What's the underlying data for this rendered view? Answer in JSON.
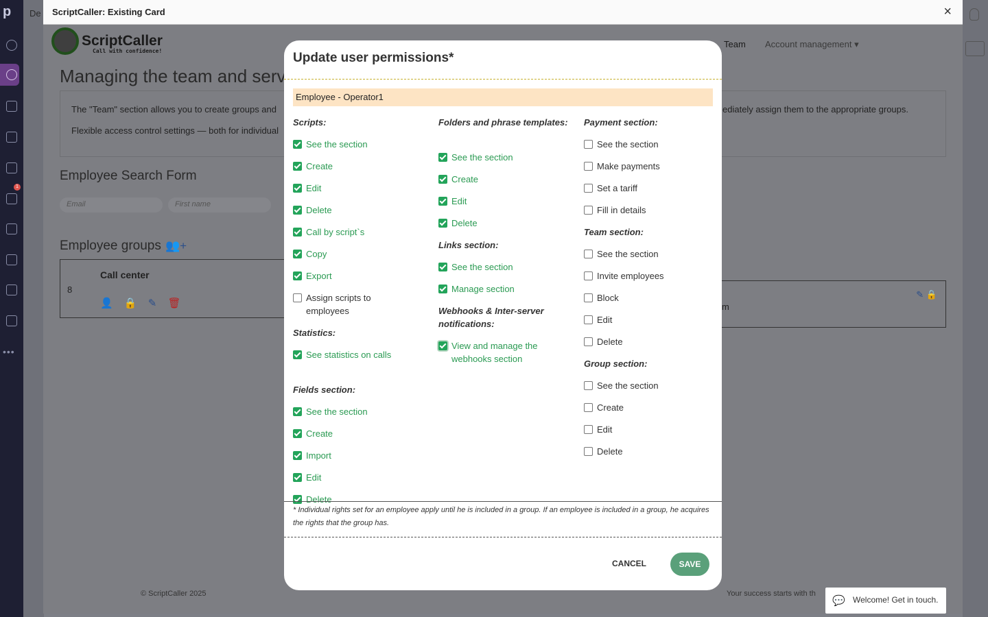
{
  "window": {
    "title": "ScriptCaller: Existing Card",
    "close_glyph": "×"
  },
  "background": {
    "strip_text": "De",
    "brand": {
      "name": "ScriptCaller",
      "tagline": "Call with confidence!"
    },
    "nav": {
      "team": "Team",
      "account": "Account management ▾"
    },
    "heading": "Managing the team and serv",
    "info_line1": "The \"Team\" section allows you to create groups and",
    "info_line1_end": "ediately assign them to the appropriate groups.",
    "info_line2": "Flexible access control settings — both for individual",
    "search_heading": "Employee Search Form",
    "search_email": "Email",
    "search_first": "First name",
    "groups_heading": "Employee groups",
    "group": {
      "count": "8",
      "name": "Call center",
      "name_suffix": "◉"
    },
    "group2_text": "m",
    "footer_left": "© ScriptCaller 2025",
    "footer_right": "Your success starts with th",
    "sidebar_badge": "1",
    "sidebar_dots": "•••"
  },
  "chat": {
    "text": "Welcome! Get in touch."
  },
  "modal": {
    "title": "Update user permissions*",
    "employee": "Employee - Operator1",
    "columns": [
      {
        "sections": [
          {
            "title": "Scripts:",
            "items": [
              {
                "label": "See the section",
                "checked": true
              },
              {
                "label": "Create",
                "checked": true
              },
              {
                "label": "Edit",
                "checked": true
              },
              {
                "label": "Delete",
                "checked": true
              },
              {
                "label": "Call by script`s",
                "checked": true
              },
              {
                "label": "Copy",
                "checked": true
              },
              {
                "label": "Export",
                "checked": true
              },
              {
                "label": "Assign scripts to employees",
                "checked": false
              }
            ]
          },
          {
            "title": "Statistics:",
            "items": [
              {
                "label": "See statistics on calls",
                "checked": true
              }
            ]
          },
          {
            "title": "Fields section:",
            "items": [
              {
                "label": "See the section",
                "checked": true
              },
              {
                "label": "Create",
                "checked": true
              },
              {
                "label": "Import",
                "checked": true
              },
              {
                "label": "Edit",
                "checked": true
              },
              {
                "label": "Delete",
                "checked": true
              }
            ]
          }
        ]
      },
      {
        "sections": [
          {
            "title": "Folders and phrase templates:",
            "items": [
              {
                "label": "See the section",
                "checked": true
              },
              {
                "label": "Create",
                "checked": true
              },
              {
                "label": "Edit",
                "checked": true
              },
              {
                "label": "Delete",
                "checked": true
              }
            ]
          },
          {
            "title": "Links section:",
            "items": [
              {
                "label": "See the section",
                "checked": true
              },
              {
                "label": "Manage section",
                "checked": true
              }
            ]
          },
          {
            "title": "Webhooks & Inter-server notifications:",
            "items": [
              {
                "label": "View and manage the webhooks section",
                "checked": true,
                "focused": true
              }
            ]
          }
        ]
      },
      {
        "sections": [
          {
            "title": "Payment section:",
            "items": [
              {
                "label": "See the section",
                "checked": false
              },
              {
                "label": "Make payments",
                "checked": false
              },
              {
                "label": "Set a tariff",
                "checked": false
              },
              {
                "label": "Fill in details",
                "checked": false
              }
            ]
          },
          {
            "title": "Team section:",
            "items": [
              {
                "label": "See the section",
                "checked": false
              },
              {
                "label": "Invite employees",
                "checked": false
              },
              {
                "label": "Block",
                "checked": false
              },
              {
                "label": "Edit",
                "checked": false
              },
              {
                "label": "Delete",
                "checked": false
              }
            ]
          },
          {
            "title": "Group section:",
            "items": [
              {
                "label": "See the section",
                "checked": false
              },
              {
                "label": "Create",
                "checked": false
              },
              {
                "label": "Edit",
                "checked": false
              },
              {
                "label": "Delete",
                "checked": false
              }
            ]
          }
        ]
      }
    ],
    "footnote": "* Individual rights set for an employee apply until he is included in a group. If an employee is included in a group, he acquires the rights that the group has.",
    "cancel_label": "CANCEL",
    "save_label": "SAVE"
  },
  "colors": {
    "checked": "#23a45a",
    "save_button": "#5aa07a",
    "employee_bar": "#fde4c4",
    "sidebar": "#1e1f33"
  }
}
